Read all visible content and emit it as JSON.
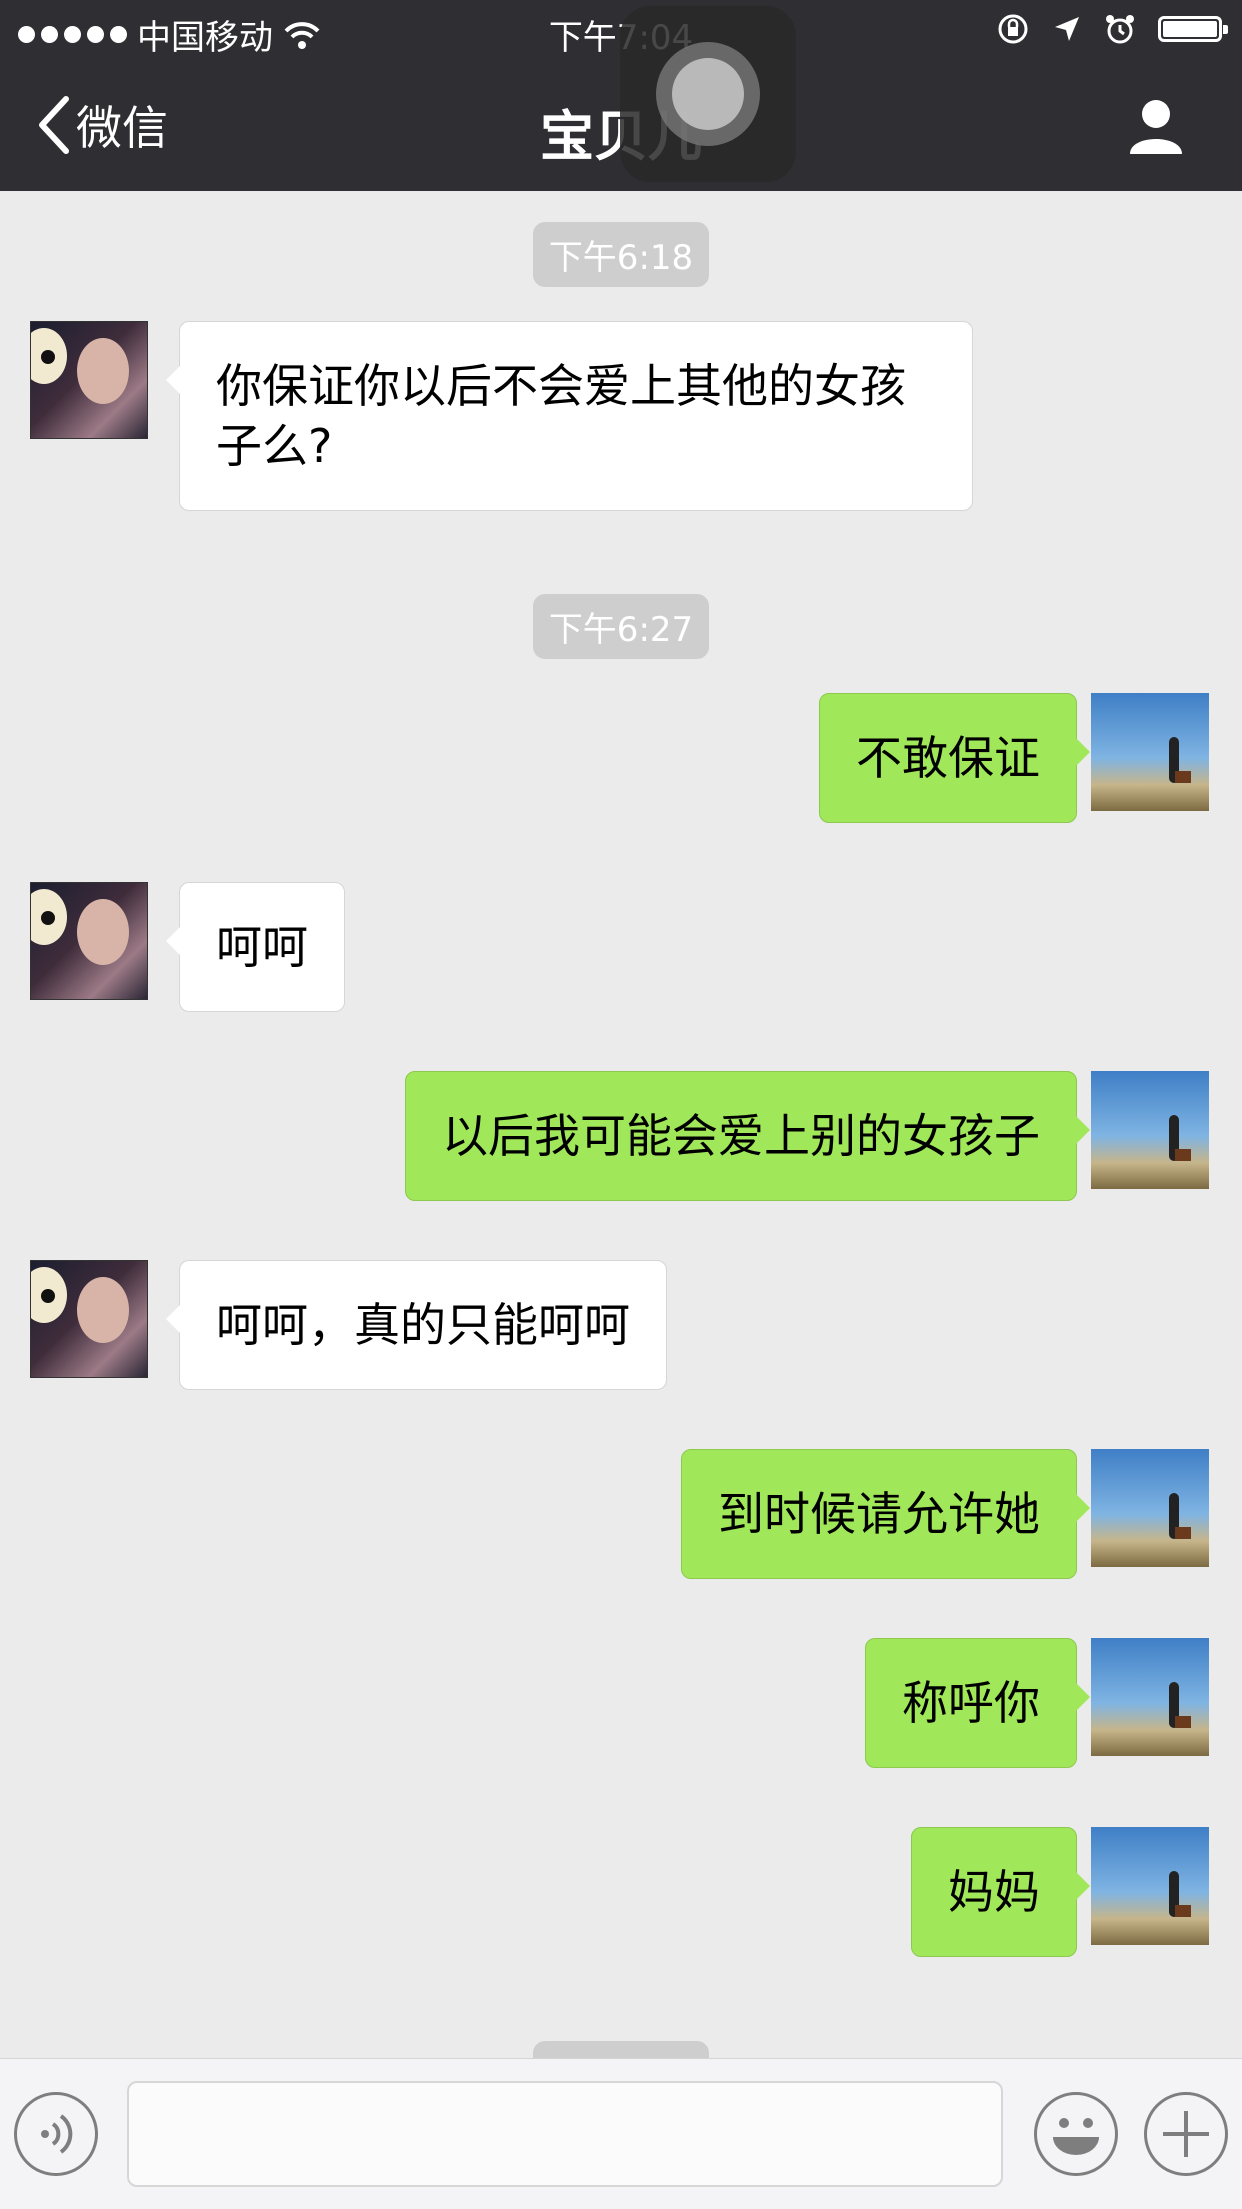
{
  "status_bar": {
    "carrier": "中国移动",
    "time": "下午7:04",
    "icons": [
      "signal-dots-icon",
      "wifi-icon",
      "orientation-lock-icon",
      "location-icon",
      "alarm-icon",
      "battery-icon"
    ]
  },
  "nav": {
    "back_label": "微信",
    "title": "宝贝儿",
    "profile_icon": "person-icon"
  },
  "messages": [
    {
      "type": "timestamp",
      "text": "下午6:18"
    },
    {
      "type": "incoming",
      "text": "你保证你以后不会爱上其他的女孩子么?"
    },
    {
      "type": "timestamp",
      "text": "下午6:27"
    },
    {
      "type": "outgoing",
      "text": "不敢保证"
    },
    {
      "type": "incoming",
      "text": "呵呵"
    },
    {
      "type": "outgoing",
      "text": "以后我可能会爱上别的女孩子"
    },
    {
      "type": "incoming",
      "text": "呵呵，真的只能呵呵"
    },
    {
      "type": "outgoing",
      "text": "到时候请允许她"
    },
    {
      "type": "outgoing",
      "text": "称呼你"
    },
    {
      "type": "outgoing",
      "text": "妈妈"
    }
  ],
  "input_bar": {
    "icons": [
      "voice-icon",
      "emoji-icon",
      "plus-icon"
    ],
    "field_value": ""
  }
}
